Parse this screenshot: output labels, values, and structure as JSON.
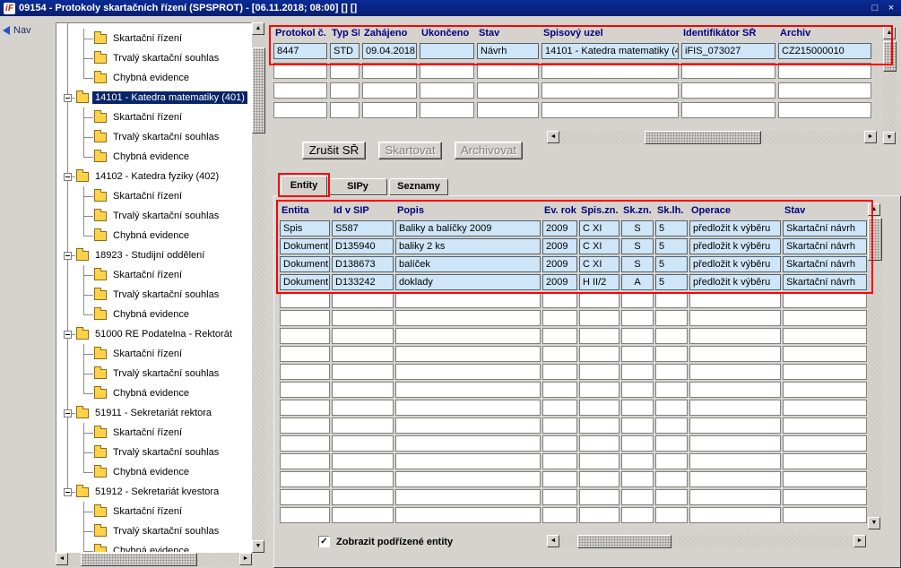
{
  "window": {
    "title": "09154 - Protokoly skartačních řízení (SPSPROT) - [06.11.2018; 08:00]  []  []",
    "logo_text": "iF"
  },
  "nav": {
    "label": "Nav"
  },
  "icons": {
    "up": "▲",
    "down": "▼",
    "left": "◄",
    "right": "►",
    "check": "✓",
    "restore": "□",
    "close": "×"
  },
  "colors": {
    "highlight": "#ff0000",
    "selection": "#0a246a",
    "cellbg": "#cfe6f8",
    "headertext": "#000080",
    "titlebar": "#0a2a96"
  },
  "tree": {
    "items": [
      {
        "label": "Skartační řízení",
        "level": 2
      },
      {
        "label": "Trvalý skartační souhlas",
        "level": 2
      },
      {
        "label": "Chybná evidence",
        "level": 2
      },
      {
        "label": "14101 - Katedra matematiky (401)",
        "level": 1,
        "selected": true
      },
      {
        "label": "Skartační řízení",
        "level": 2
      },
      {
        "label": "Trvalý skartační souhlas",
        "level": 2
      },
      {
        "label": "Chybná evidence",
        "level": 2
      },
      {
        "label": "14102 - Katedra fyziky (402)",
        "level": 1
      },
      {
        "label": "Skartační řízení",
        "level": 2
      },
      {
        "label": "Trvalý skartační souhlas",
        "level": 2
      },
      {
        "label": "Chybná evidence",
        "level": 2
      },
      {
        "label": "18923 - Studijní oddělení",
        "level": 1
      },
      {
        "label": "Skartační řízení",
        "level": 2
      },
      {
        "label": "Trvalý skartační souhlas",
        "level": 2
      },
      {
        "label": "Chybná evidence",
        "level": 2
      },
      {
        "label": "51000 RE Podatelna - Rektorát",
        "level": 1
      },
      {
        "label": "Skartační řízení",
        "level": 2
      },
      {
        "label": "Trvalý skartační souhlas",
        "level": 2
      },
      {
        "label": "Chybná evidence",
        "level": 2
      },
      {
        "label": "51911 - Sekretariát rektora",
        "level": 1
      },
      {
        "label": "Skartační řízení",
        "level": 2
      },
      {
        "label": "Trvalý skartační souhlas",
        "level": 2
      },
      {
        "label": "Chybná evidence",
        "level": 2
      },
      {
        "label": "51912 - Sekretariát kvestora",
        "level": 1
      },
      {
        "label": "Skartační řízení",
        "level": 2
      },
      {
        "label": "Trvalý skartační souhlas",
        "level": 2
      },
      {
        "label": "Chybná evidence",
        "level": 2
      }
    ]
  },
  "protocol_table": {
    "columns": [
      "Protokol č.",
      "Typ SŘ",
      "Zahájeno",
      "Ukončeno",
      "Stav",
      "Spisový uzel",
      "Identifikátor SŘ",
      "Archiv"
    ],
    "rows": [
      [
        "8447",
        "STD",
        "09.04.2018",
        "",
        "Návrh",
        "14101 - Katedra matematiky (4",
        "iFIS_073027",
        "CZ215000010"
      ]
    ],
    "empty_rows": 3
  },
  "actions": [
    {
      "label": "Zrušit SŘ",
      "enabled": true
    },
    {
      "label": "Skartovat",
      "enabled": false
    },
    {
      "label": "Archivovat",
      "enabled": false
    }
  ],
  "tabs": [
    {
      "label": "Entity",
      "active": true
    },
    {
      "label": "SIPy",
      "active": false
    },
    {
      "label": "Seznamy",
      "active": false
    }
  ],
  "entity_table": {
    "columns": [
      "Entita",
      "Id v SIP",
      "Popis",
      "Ev. rok",
      "Spis.zn.",
      "Sk.zn.",
      "Sk.lh.",
      "Operace",
      "Stav"
    ],
    "rows": [
      [
        "Spis",
        "S587",
        "Baliky a balíčky 2009",
        "2009",
        "C XI",
        "S",
        "5",
        "předložit k výběru",
        "Skartační návrh"
      ],
      [
        "Dokument",
        "D135940",
        "baliky 2 ks",
        "2009",
        "C XI",
        "S",
        "5",
        "předložit k výběru",
        "Skartační návrh"
      ],
      [
        "Dokument",
        "D138673",
        "balíček",
        "2009",
        "C XI",
        "S",
        "5",
        "předložit k výběru",
        "Skartační návrh"
      ],
      [
        "Dokument",
        "D133242",
        "doklady",
        "2009",
        "H II/2",
        "A",
        "5",
        "předložit k výběru",
        "Skartační návrh"
      ]
    ],
    "empty_rows": 13
  },
  "footer": {
    "checkbox_label": "Zobrazit podřízené entity",
    "checked": true
  }
}
